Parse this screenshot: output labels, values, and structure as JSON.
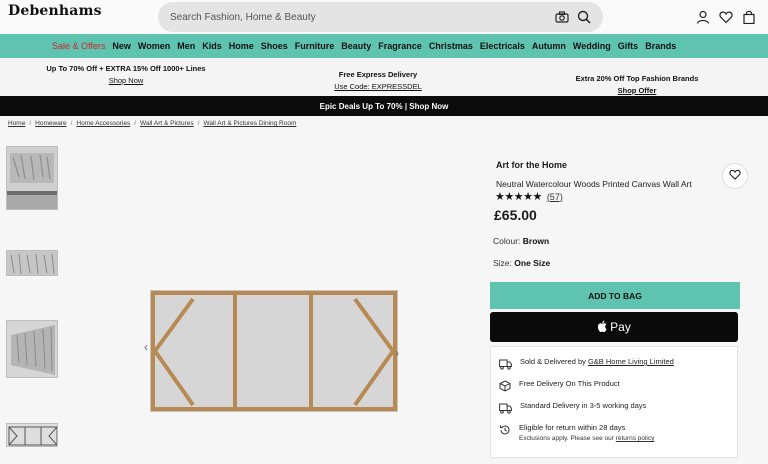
{
  "header": {
    "logo": "Debenhams",
    "search_placeholder": "Search Fashion, Home & Beauty"
  },
  "nav": {
    "items": [
      "Sale & Offers",
      "New",
      "Women",
      "Men",
      "Kids",
      "Home",
      "Shoes",
      "Furniture",
      "Beauty",
      "Fragrance",
      "Christmas",
      "Electricals",
      "Autumn",
      "Wedding",
      "Gifts",
      "Brands"
    ]
  },
  "promos": {
    "left": {
      "text": "Up To 70% Off + EXTRA 15% Off 1000+ Lines",
      "link": "Shop Now"
    },
    "center": {
      "text": "Free Express Delivery",
      "link": "Use Code: EXPRESSDEL"
    },
    "right": {
      "text": "Extra 20% Off Top Fashion Brands",
      "link": "Shop Offer"
    }
  },
  "epic_banner": "Epic Deals Up To 70% | Shop Now",
  "breadcrumb": [
    "Home",
    "Homeware",
    "Home Accessories",
    "Wall Art & Pictures",
    "Wall Art & Pictures Dining Room"
  ],
  "product": {
    "brand": "Art for the Home",
    "name": "Neutral Watercolour Woods Printed Canvas Wall Art",
    "stars": "★★★★★",
    "review_count": "(57)",
    "price": "£65.00",
    "colour_label": "Colour:",
    "colour_value": "Brown",
    "size_label": "Size:",
    "size_value": "One Size",
    "add_to_bag": "ADD TO BAG",
    "apple_pay": "Pay",
    "rating": 5
  },
  "delivery": {
    "sold_prefix": "Sold & Delivered by",
    "seller": "G&B Home Living Limited",
    "free_delivery": "Free Delivery On This Product",
    "standard": "Standard Delivery in 3-5 working days",
    "returns": "Eligible for return within 28 days",
    "returns_sub_prefix": "Exclusions apply. Please see our",
    "returns_link": "returns policy"
  },
  "icons": [
    "camera-icon",
    "search-icon",
    "account-icon",
    "heart-icon",
    "bag-icon",
    "apple-icon",
    "seller-icon",
    "box-icon",
    "truck-icon",
    "returns-icon",
    "chevron-left-icon",
    "chevron-right-icon"
  ],
  "colors": {
    "accent": "#5ec4b0",
    "sale": "#d0232c",
    "black": "#0b0b0b"
  }
}
